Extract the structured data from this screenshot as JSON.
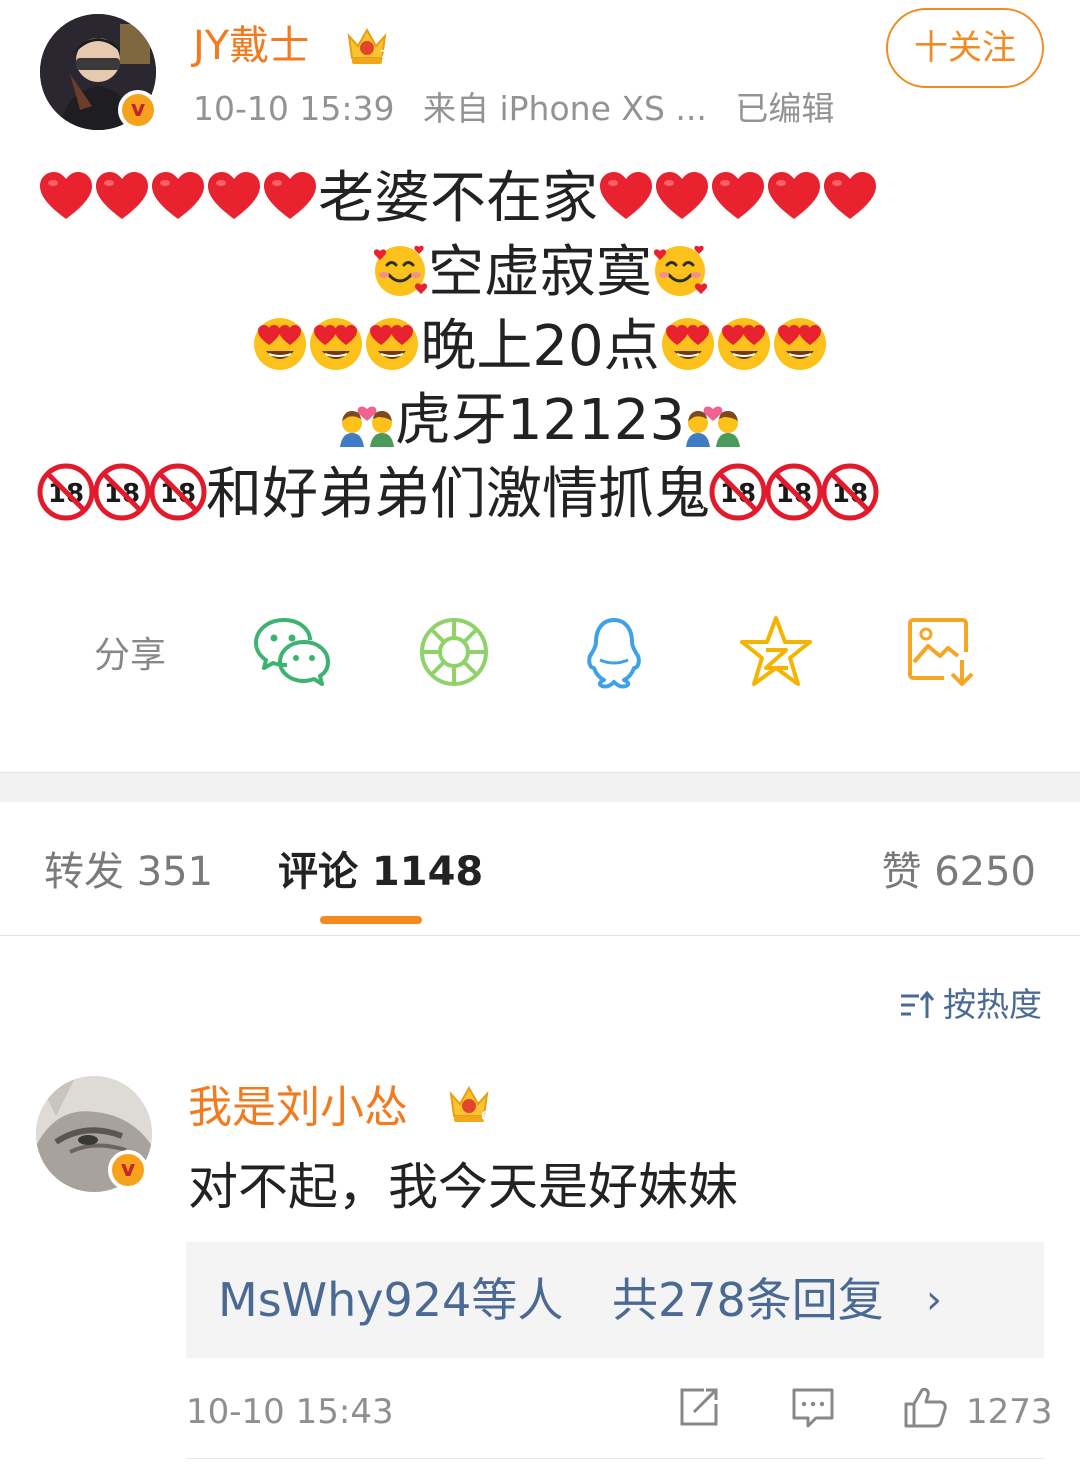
{
  "post": {
    "author": "JY戴士",
    "author_level": "7",
    "timestamp": "10-10 15:39",
    "source": "来自 iPhone XS ...",
    "edited": "已编辑",
    "follow_label": "十关注",
    "lines": [
      {
        "left_emoji": "heart",
        "left_count": 5,
        "text": "老婆不在家",
        "right_emoji": "heart",
        "right_count": 5
      },
      {
        "left_emoji": "smiling-hearts",
        "left_count": 1,
        "text": "空虚寂寞",
        "right_emoji": "smiling-hearts",
        "right_count": 1
      },
      {
        "left_emoji": "heart-eyes",
        "left_count": 3,
        "text": "晚上20点",
        "right_emoji": "heart-eyes",
        "right_count": 3
      },
      {
        "left_emoji": "couple-kiss",
        "left_count": 1,
        "text": "虎牙12123",
        "right_emoji": "couple-kiss",
        "right_count": 1
      },
      {
        "left_emoji": "no-under-18",
        "left_count": 3,
        "text": "和好弟弟们激情抓鬼",
        "right_emoji": "no-under-18",
        "right_count": 3
      }
    ]
  },
  "share": {
    "label": "分享",
    "icons": [
      "wechat-icon",
      "moments-icon",
      "qq-icon",
      "qzone-icon",
      "save-image-icon"
    ],
    "colors": {
      "wechat": "#3cb371",
      "moments": "#8fd26a",
      "qq": "#3fa1e8",
      "qzone": "#f5b400",
      "save": "#f5a623"
    }
  },
  "tabs": {
    "repost": "转发 351",
    "comments": "评论 1148",
    "likes": "赞 6250"
  },
  "sort": {
    "label": "按热度"
  },
  "comment": {
    "author": "我是刘小怂",
    "author_level": "6",
    "text": "对不起，我今天是好妹妹",
    "reply_names": "MsWhy924等人",
    "reply_count": "共278条回复",
    "reply_chevron": "›",
    "timestamp": "10-10 15:43",
    "like_count": "1273"
  },
  "colors": {
    "accent_orange": "#f27b1f",
    "link_blue": "#4a6a94",
    "muted_gray": "#939393"
  }
}
